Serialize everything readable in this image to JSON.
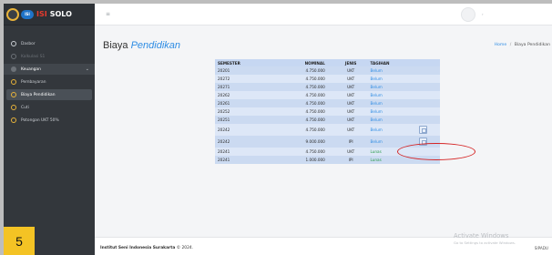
{
  "brand": {
    "badge": "ISI",
    "name_red": "ISI",
    "name_white": "SOLO"
  },
  "sidebar": {
    "items": [
      {
        "label": "Dasbor"
      },
      {
        "label": "Kalkulasi S1"
      },
      {
        "label": "Keuangan"
      },
      {
        "label": "Pembayaran"
      },
      {
        "label": "Biaya Pendidikan"
      },
      {
        "label": "Cuti"
      },
      {
        "label": "Potongan UKT 50%"
      }
    ]
  },
  "header": {
    "menu_icon": "≡",
    "profile_caret": "›"
  },
  "page": {
    "title_plain": "Biaya",
    "title_italic": "Pendidikan",
    "breadcrumb": {
      "home": "Home",
      "separator": "/",
      "current": "Biaya Pendidikan"
    }
  },
  "table": {
    "headers": [
      "SEMESTER",
      "NOMINAL",
      "JENIS",
      "TAGIHAN"
    ],
    "rows": [
      {
        "semester": "20201",
        "nominal": "4.750.000",
        "jenis": "UKT",
        "tagihan": "Belum"
      },
      {
        "semester": "20272",
        "nominal": "4.750.000",
        "jenis": "UKT",
        "tagihan": "Belum"
      },
      {
        "semester": "20271",
        "nominal": "4.750.000",
        "jenis": "UKT",
        "tagihan": "Belum"
      },
      {
        "semester": "20262",
        "nominal": "4.750.000",
        "jenis": "UKT",
        "tagihan": "Belum"
      },
      {
        "semester": "20261",
        "nominal": "4.750.000",
        "jenis": "UKT",
        "tagihan": "Belum"
      },
      {
        "semester": "20252",
        "nominal": "4.750.000",
        "jenis": "UKT",
        "tagihan": "Belum"
      },
      {
        "semester": "20251",
        "nominal": "4.750.000",
        "jenis": "UKT",
        "tagihan": "Belum"
      },
      {
        "semester": "20242",
        "nominal": "4.750.000",
        "jenis": "UKT",
        "tagihan": "Belum"
      },
      {
        "semester": "20242",
        "nominal": "9.000.000",
        "jenis": "IPI",
        "tagihan": "Belum"
      },
      {
        "semester": "20241",
        "nominal": "4.750.000",
        "jenis": "UKT",
        "tagihan": "Lunas"
      },
      {
        "semester": "20241",
        "nominal": "1.000.000",
        "jenis": "IPI",
        "tagihan": "Lunas"
      }
    ]
  },
  "overlay": {
    "step_number": "5"
  },
  "footer": {
    "institution": "Institut Seni Indonesia Surakarta",
    "copyright": "© 2024.",
    "right": "SIPADU"
  },
  "watermark": {
    "title": "Activate Windows",
    "subtitle": "Go to Settings to activate Windows."
  },
  "colors": {
    "accent": "#2f8de4",
    "sidebar": "#33373c",
    "badge_yellow": "#f4c324",
    "annotation_red": "#d52424",
    "lunas": "#2a9d4a"
  }
}
